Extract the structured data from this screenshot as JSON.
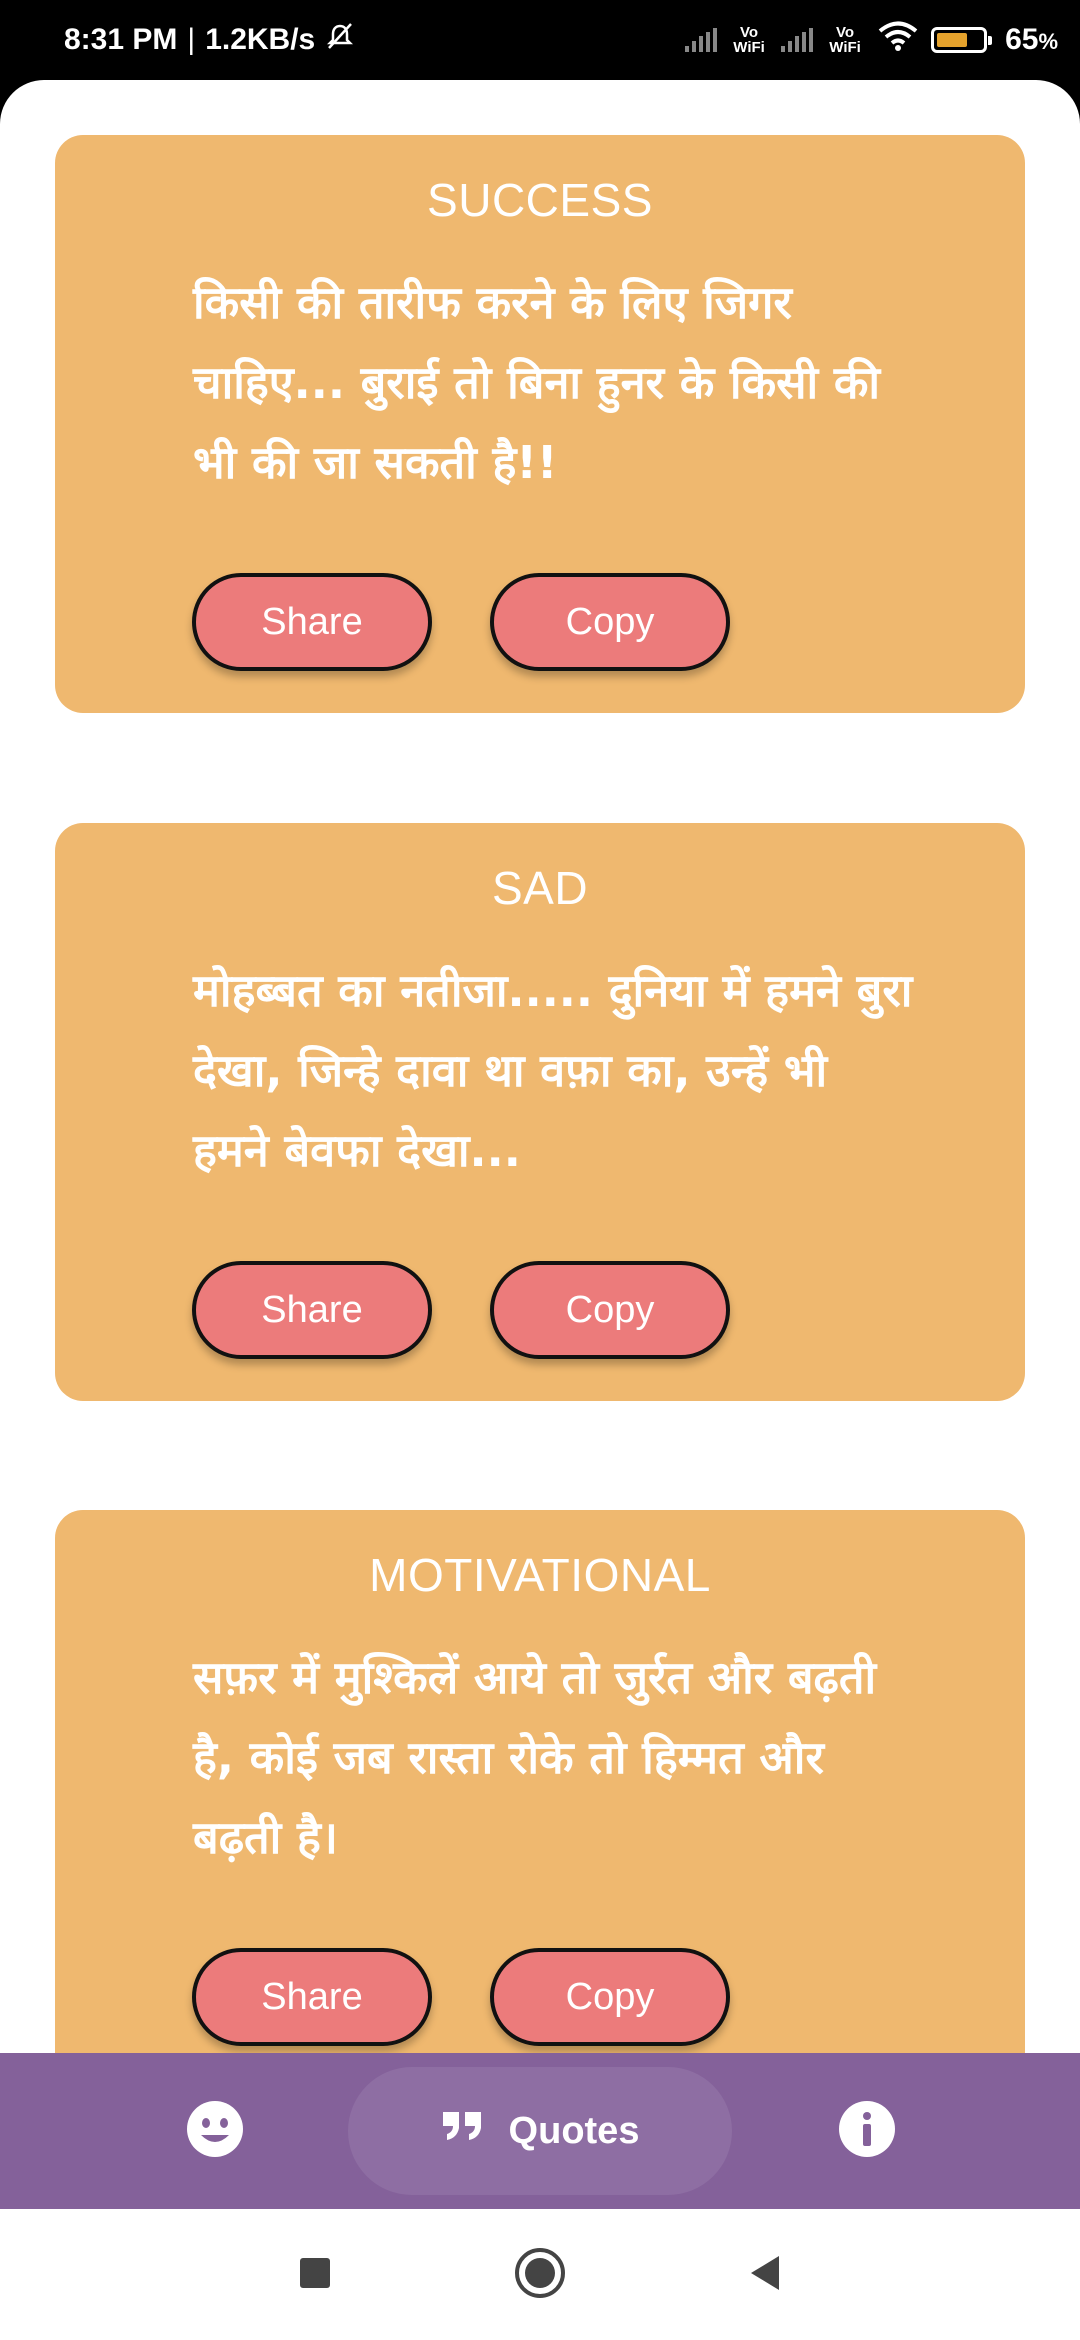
{
  "status_bar": {
    "time": "8:31 PM",
    "separator": "|",
    "speed": "1.2KB/s",
    "volte1": "Vo WiFi",
    "volte2": "Vo WiFi",
    "battery_percent": "65",
    "battery_unit": "%",
    "battery_level": 0.65,
    "icons": [
      "alarm-off-icon",
      "signal-icon",
      "wifi-icon",
      "battery-icon"
    ]
  },
  "cards": [
    {
      "title": "SUCCESS",
      "text": "किसी की तारीफ करने के लिए जिगर चाहिए... बुराई तो बिना हुनर के किसी की भी की जा सकती है!!",
      "share_label": "Share",
      "copy_label": "Copy"
    },
    {
      "title": "SAD",
      "text": "मोहब्बत का नतीजा..... दुनिया में हमने बुरा देखा, जिन्हे दावा था वफ़ा का, उन्हें भी हमने बेवफा देखा...",
      "share_label": "Share",
      "copy_label": "Copy"
    },
    {
      "title": "MOTIVATIONAL",
      "text": "सफ़र में मुश्किलें आये तो जुर्रत और बढ़ती है, कोई जब रास्ता रोके तो हिम्मत और बढ़ती है।",
      "share_label": "Share",
      "copy_label": "Copy"
    }
  ],
  "bottom_nav": {
    "items": [
      {
        "icon": "emoji-icon"
      },
      {
        "icon": "quote-icon",
        "label": "Quotes",
        "selected": true
      },
      {
        "icon": "info-icon"
      }
    ]
  },
  "system_nav": {
    "icons": [
      "recent-apps-icon",
      "home-icon",
      "back-icon"
    ]
  },
  "colors": {
    "card_bg": "#efb86f",
    "button_bg": "#ec7b7b",
    "nav_bg": "#84619a",
    "nav_selected_bg": "#8e6ea3"
  }
}
